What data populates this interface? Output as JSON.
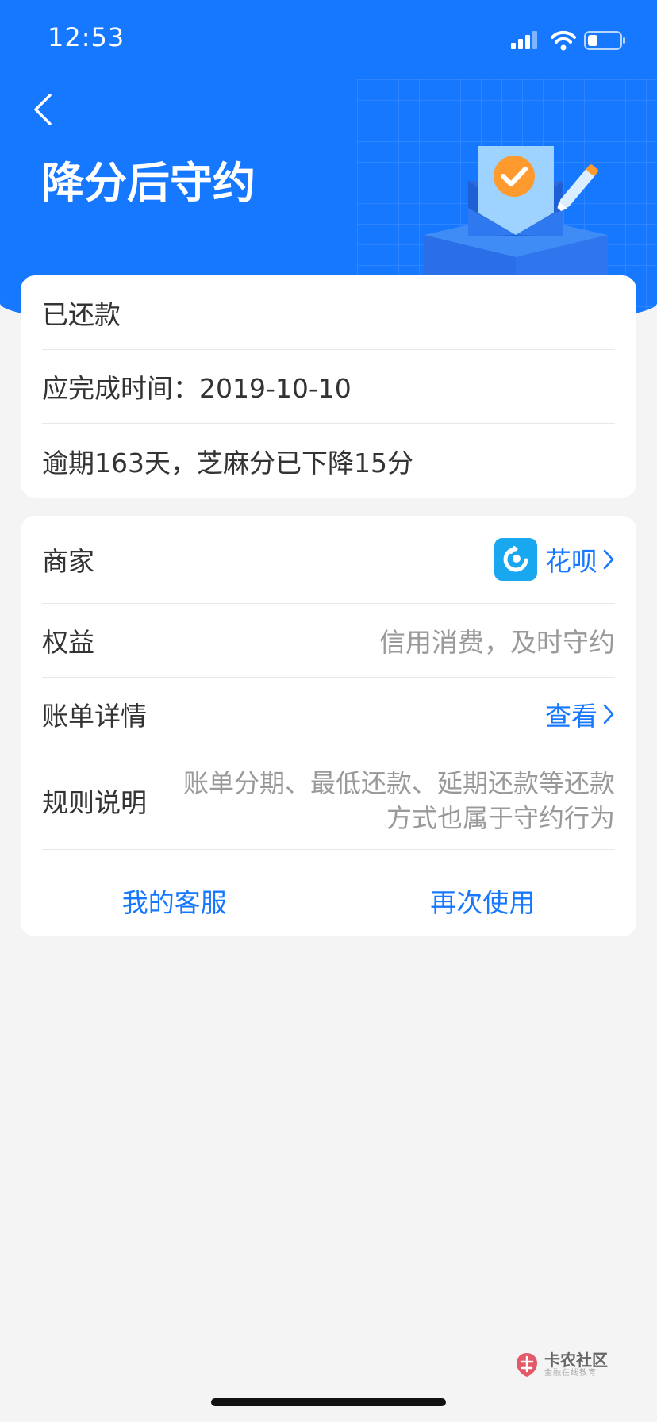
{
  "status_bar": {
    "time": "12:53",
    "icons": [
      "signal-icon",
      "wifi-icon",
      "battery-icon"
    ]
  },
  "header": {
    "title": "降分后守约",
    "back_icon": "chevron-left-icon",
    "illustration": "envelope-check-pencil-illustration",
    "background_color": "#1677ff"
  },
  "status_card": {
    "status": "已还款",
    "deadline": "应完成时间：2019-10-10",
    "overdue_note": "逾期163天，芝麻分已下降15分"
  },
  "detail_card": {
    "merchant_label": "商家",
    "merchant_value": "花呗",
    "merchant_icon": "huabei-logo-icon",
    "rights_label": "权益",
    "rights_value": "信用消费，及时守约",
    "bill_label": "账单详情",
    "bill_value": "查看",
    "rules_label": "规则说明",
    "rules_value_line1": "账单分期、最低还款、延期还款等还款",
    "rules_value_line2": "方式也属于守约行为",
    "action_service": "我的客服",
    "action_reuse": "再次使用",
    "link_color": "#1677ff"
  },
  "watermark": {
    "title": "卡农社区",
    "subtitle": "金融在线教育"
  }
}
